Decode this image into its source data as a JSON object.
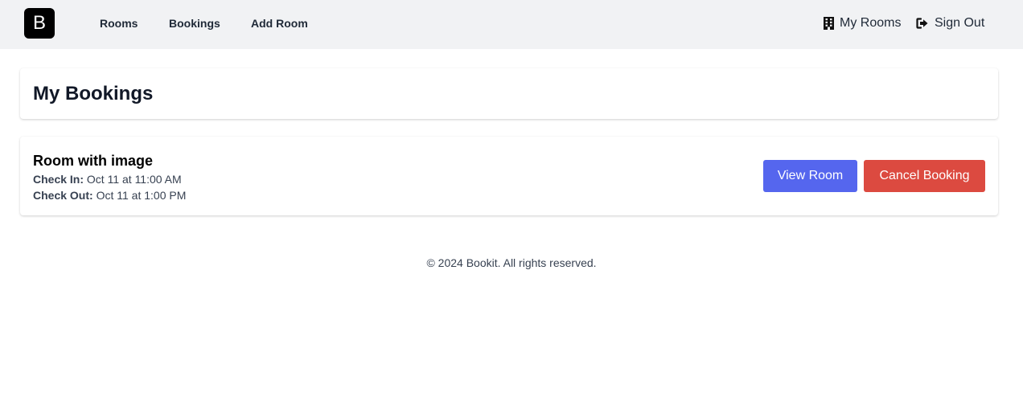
{
  "header": {
    "logo_letter": "B",
    "nav": [
      {
        "label": "Rooms"
      },
      {
        "label": "Bookings"
      },
      {
        "label": "Add Room"
      }
    ],
    "my_rooms": {
      "label": "My Rooms",
      "icon": "building-icon"
    },
    "sign_out": {
      "label": "Sign Out",
      "icon": "sign-out-icon"
    }
  },
  "page": {
    "title": "My Bookings"
  },
  "bookings": [
    {
      "room_name": "Room with image",
      "check_in_label": "Check In:",
      "check_in_value": "Oct 11 at 11:00 AM",
      "check_out_label": "Check Out:",
      "check_out_value": "Oct 11 at 1:00 PM",
      "view_label": "View Room",
      "cancel_label": "Cancel Booking"
    }
  ],
  "footer": {
    "text": "© 2024 Bookit. All rights reserved."
  },
  "colors": {
    "header_bg": "#f1f2f4",
    "view_button": "#5566ee",
    "cancel_button": "#dc4a40",
    "logo_bg": "#000000"
  }
}
